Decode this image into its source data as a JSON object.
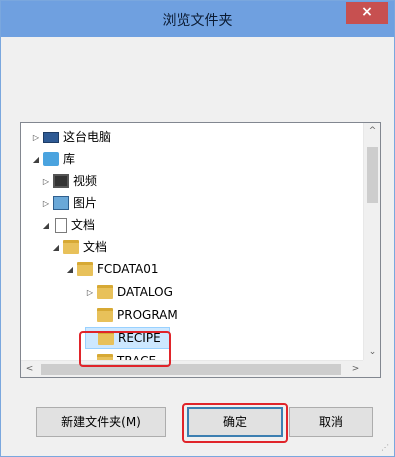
{
  "window": {
    "title": "浏览文件夹",
    "close_glyph": "×"
  },
  "tree": {
    "items": [
      {
        "label": "这台电脑",
        "icon": "computer-icon",
        "expander": "▷"
      },
      {
        "label": "库",
        "icon": "library-icon",
        "expander": "◢"
      },
      {
        "label": "视频",
        "icon": "video-icon",
        "expander": "▷"
      },
      {
        "label": "图片",
        "icon": "pictures-icon",
        "expander": "▷"
      },
      {
        "label": "文档",
        "icon": "documents-icon",
        "expander": "◢"
      },
      {
        "label": "文档",
        "icon": "folder-icon",
        "expander": "◢"
      },
      {
        "label": "FCDATA01",
        "icon": "folder-icon",
        "expander": "◢"
      },
      {
        "label": "DATALOG",
        "icon": "folder-icon",
        "expander": "▷"
      },
      {
        "label": "PROGRAM",
        "icon": "folder-icon",
        "expander": ""
      },
      {
        "label": "RECIPE",
        "icon": "folder-icon",
        "expander": "",
        "selected": true
      },
      {
        "label": "TRACE",
        "icon": "folder-icon",
        "expander": ""
      }
    ],
    "scroll_up": "^",
    "scroll_down": "⌄",
    "scroll_left": "<",
    "scroll_right": ">"
  },
  "buttons": {
    "new_folder": "新建文件夹(M)",
    "ok": "确定",
    "cancel": "取消"
  },
  "colors": {
    "titlebar": "#6fa0e0",
    "close": "#c75050",
    "highlight": "#e0242a",
    "selection": "#cde8ff"
  }
}
